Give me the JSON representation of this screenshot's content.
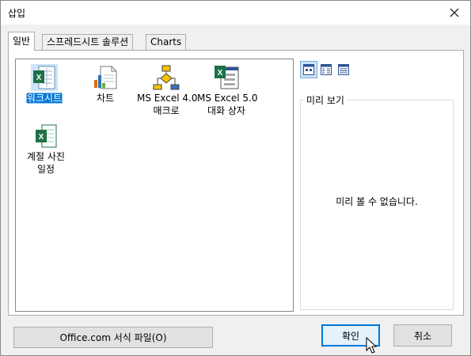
{
  "window": {
    "title": "삽입"
  },
  "tabs": [
    {
      "label": "일반",
      "active": true
    },
    {
      "label": "스프레드시트 솔루션",
      "active": false
    },
    {
      "label": "Charts",
      "active": false
    }
  ],
  "items": [
    {
      "line1": "워크시트",
      "line2": "",
      "icon": "excel-worksheet-icon",
      "selected": true
    },
    {
      "line1": "차트",
      "line2": "",
      "icon": "chart-document-icon",
      "selected": false
    },
    {
      "line1": "MS Excel 4.0",
      "line2": "매크로",
      "icon": "macro-flowchart-icon",
      "selected": false
    },
    {
      "line1": "MS Excel 5.0",
      "line2": "대화 상자",
      "icon": "excel-dialog-icon",
      "selected": false
    },
    {
      "line1": "계절 사진",
      "line2": "일정",
      "icon": "excel-template-icon",
      "selected": false
    }
  ],
  "view_buttons": [
    {
      "icon": "large-icons-view-icon",
      "active": true
    },
    {
      "icon": "list-view-icon",
      "active": false
    },
    {
      "icon": "details-view-icon",
      "active": false
    }
  ],
  "preview": {
    "caption": "미리 보기",
    "message": "미리 볼 수 없습니다."
  },
  "buttons": {
    "office": "Office.com 서식 파일(O)",
    "ok": "확인",
    "cancel": "취소"
  },
  "colors": {
    "selection": "#0078d7",
    "excel_green": "#1e7145",
    "chart_orange": "#e36c0a"
  }
}
